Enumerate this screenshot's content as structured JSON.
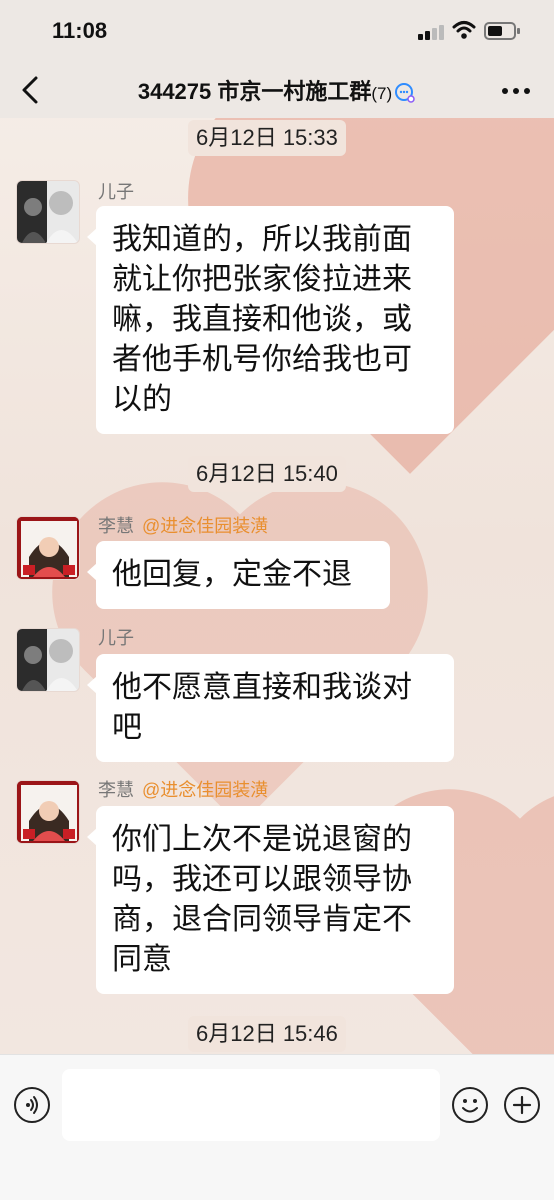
{
  "status_bar": {
    "time": "11:08"
  },
  "nav": {
    "title": "344275 市京一村施工群",
    "member_count": "(7)"
  },
  "messages": [
    {
      "type": "time",
      "text": "6月12日 15:33"
    },
    {
      "type": "msg",
      "sender": "儿子",
      "mention": "",
      "avatar": "son-avatar",
      "lines": [
        "我知道的，所以我前面",
        "就让你把张家俊拉进来",
        "嘛，我直接和他谈，或",
        "者他手机号你给我也可",
        "以的"
      ]
    },
    {
      "type": "time",
      "text": "6月12日 15:40"
    },
    {
      "type": "msg",
      "sender": "李慧",
      "mention": "@进念佳园装潢",
      "avatar": "lihui-avatar",
      "lines": [
        "他回复，定金不退"
      ]
    },
    {
      "type": "msg",
      "sender": "儿子",
      "mention": "",
      "avatar": "son-avatar",
      "lines": [
        "他不愿意直接和我谈对",
        "吧"
      ]
    },
    {
      "type": "msg",
      "sender": "李慧",
      "mention": "@进念佳园装潢",
      "avatar": "lihui-avatar",
      "lines": [
        "你们上次不是说退窗的",
        "吗，我还可以跟领导协",
        "商，退合同领导肯定不",
        "同意"
      ]
    },
    {
      "type": "time",
      "text": "6月12日 15:46"
    }
  ],
  "input": {
    "value": "",
    "placeholder": ""
  },
  "colors": {
    "bubble": "#ffffff",
    "mention": "#e98f2f",
    "sender": "#777777",
    "heart": "#e49c8a"
  }
}
